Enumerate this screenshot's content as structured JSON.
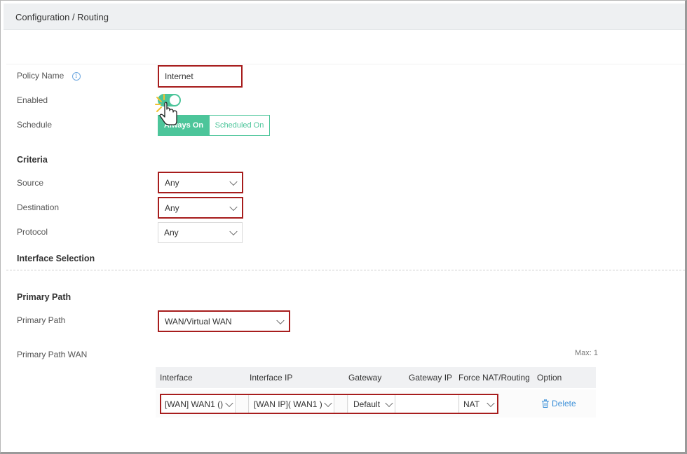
{
  "breadcrumb": "Configuration / Routing",
  "form": {
    "policy_name_label": "Policy Name",
    "policy_name_value": "Internet",
    "enabled_label": "Enabled",
    "enabled": true,
    "schedule_label": "Schedule",
    "schedule_options": [
      "Always On",
      "Scheduled On"
    ],
    "schedule_selected": "Always On"
  },
  "criteria": {
    "title": "Criteria",
    "source_label": "Source",
    "source_value": "Any",
    "destination_label": "Destination",
    "destination_value": "Any",
    "protocol_label": "Protocol",
    "protocol_value": "Any"
  },
  "interface_selection_title": "Interface Selection",
  "primary_path": {
    "section_title": "Primary Path",
    "label": "Primary Path",
    "value": "WAN/Virtual WAN",
    "wan_label": "Primary Path WAN",
    "max_label": "Max: 1"
  },
  "table": {
    "headers": [
      "Interface",
      "Interface IP",
      "Gateway",
      "Gateway IP",
      "Force NAT/Routing",
      "Option"
    ],
    "row": {
      "interface": "[WAN] WAN1 ()",
      "interface_ip": "[WAN IP]( WAN1 )",
      "gateway": "Default",
      "gateway_ip": "",
      "force_nat": "NAT",
      "option": "Delete"
    }
  },
  "colors": {
    "accent_green": "#4cc59a",
    "highlight_red": "#a71d1d",
    "link_blue": "#3a8fd8"
  }
}
